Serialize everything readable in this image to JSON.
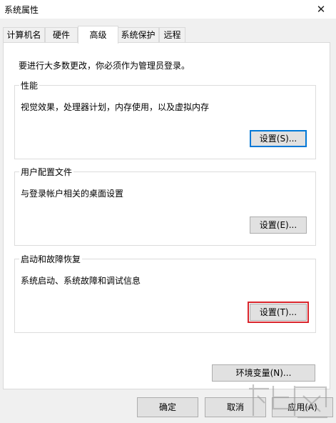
{
  "window": {
    "title": "系统属性",
    "close_glyph": "✕"
  },
  "tabs": [
    {
      "label": "计算机名"
    },
    {
      "label": "硬件"
    },
    {
      "label": "高级"
    },
    {
      "label": "系统保护"
    },
    {
      "label": "远程"
    }
  ],
  "active_tab": "高级",
  "panel": {
    "admin_note": "要进行大多数更改，你必须作为管理员登录。",
    "performance": {
      "title": "性能",
      "desc": "视觉效果，处理器计划，内存使用，以及虚拟内存",
      "button": "设置(S)..."
    },
    "profiles": {
      "title": "用户配置文件",
      "desc": "与登录帐户相关的桌面设置",
      "button": "设置(E)..."
    },
    "startup": {
      "title": "启动和故障恢复",
      "desc": "系统启动、系统故障和调试信息",
      "button": "设置(T)..."
    },
    "env_button": "环境变量(N)..."
  },
  "footer": {
    "ok": "确定",
    "cancel": "取消",
    "apply": "应用(A)"
  },
  "colors": {
    "accent": "#0078d7",
    "highlight": "#d9252c",
    "panel_bg": "#ffffff",
    "window_bg": "#f0f0f0"
  }
}
